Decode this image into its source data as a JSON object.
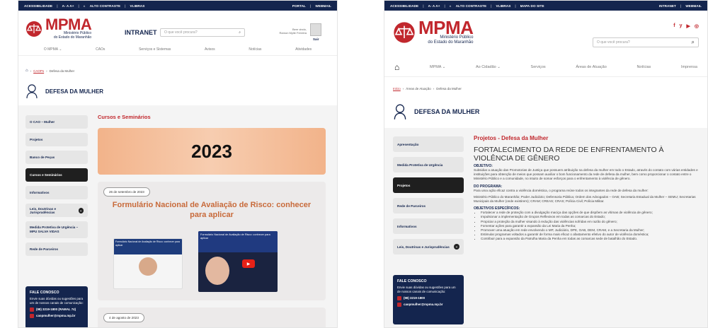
{
  "colors": {
    "navy": "#14254e",
    "red": "#c1272d"
  },
  "left": {
    "topbar": {
      "a11y": "ACESSIBILIDADE",
      "fonts": "A- A A+",
      "contrast": "ALTO CONTRASTE",
      "libras": "VLIBRAS",
      "portal": "PORTAL",
      "webmail": "WEBMAIL"
    },
    "logo": {
      "mp": "MPMA",
      "line1": "Ministério Público",
      "line2": "do Estado do Maranhão"
    },
    "intranet": "INTRANET",
    "search_placeholder": "O que você procura?",
    "user": {
      "greeting": "Bem vindo,",
      "name": "Ramon Mylle Ferreira",
      "logout": "Sair",
      "icon": "user-avatar-icon"
    },
    "nav": [
      "O MPMA",
      "CAOs",
      "Serviços e Sistemas",
      "Avisos",
      "Notícias",
      "Atividades"
    ],
    "breadcrumb": [
      "CAOPs",
      "Defesa da Mulher"
    ],
    "page_title": "DEFESA DA MULHER",
    "sidebar": [
      {
        "label": "O CAO – Mulher",
        "active": false
      },
      {
        "label": "Projetos",
        "active": false
      },
      {
        "label": "Banco de Peças",
        "active": false
      },
      {
        "label": "Cursos e Seminários",
        "active": true
      },
      {
        "label": "Informativos",
        "active": false
      },
      {
        "label": "Leis, Doutrinas e Jurisprudências",
        "active": false,
        "expand": true
      },
      {
        "label": "Medida Protetiva de Urgência – MPU SALVA VIDAS",
        "active": false
      },
      {
        "label": "Rede de Parceiros",
        "active": false
      }
    ],
    "contact": {
      "title": "FALE CONOSCO",
      "text": "Envie suas dúvidas ou sugestões para um de nossos canais de comunicação:",
      "phone": "(98) 3219-1800 (RAMAL 74)",
      "email": "caopmulher@mpma.mp.br"
    },
    "section_title": "Cursos e Seminários",
    "banner_year": "2023",
    "post1": {
      "date": "26 de setembro de 2023",
      "title": "Formulário Nacional de Avaliação de Risco: conhecer para aplicar",
      "thumb_text": "Formulário Nacional de Avaliação de Risco: conhecer para aplicar"
    },
    "post2": {
      "date": "4 de agosto de 2023"
    }
  },
  "right": {
    "topbar": {
      "a11y": "ACESSIBILIDADE",
      "fonts": "A- A A+",
      "contrast": "ALTO CONTRASTE",
      "libras": "VLIBRAS",
      "map": "MAPA DO SITE",
      "intranet": "INTRANET",
      "webmail": "WEBMAIL"
    },
    "logo": {
      "mp": "MPMA",
      "line1": "Ministério Público",
      "line2": "do Estado do Maranhão"
    },
    "social": [
      "f",
      "y",
      "▶",
      "◎"
    ],
    "search_placeholder": "O que você procura?",
    "nav": [
      "MPMA",
      "Ao Cidadão",
      "Serviços",
      "Áreas de Atuação",
      "Notícias",
      "Imprensa"
    ],
    "breadcrumb": [
      "Início",
      "Áreas de Atuação",
      "Defesa da Mulher"
    ],
    "page_title": "DEFESA DA MULHER",
    "sidebar": [
      {
        "label": "Apresentação",
        "active": false
      },
      {
        "label": "Medida Protetiva de Urgência",
        "active": false
      },
      {
        "label": "Projetos",
        "active": true
      },
      {
        "label": "Rede de Parceiros",
        "active": false
      },
      {
        "label": "Informativos",
        "active": false
      },
      {
        "label": "Leis, Doutrinas e Jurisprudências",
        "active": false,
        "expand": true
      }
    ],
    "contact": {
      "title": "FALE CONOSCO",
      "text": "Envie suas dúvidas ou sugestões para um de nossos canais de comunicação:",
      "phone": "(98) 3219-1800",
      "email": "caopmulher@mpma.mp.br"
    },
    "section_title": "Projetos - Defesa da Mulher",
    "article_title": "FORTALECIMENTO DA REDE DE ENFRENTAMENTO À VIOLÊNCIA DE GÊNERO",
    "objetivo_label": "OBJETIVO:",
    "objetivo": "Subsidiar a atuação das Promotorias de Justiça que possuem atribuição na defesa da mulher em todo o Estado, através do contato com várias entidades e instituições para obtenção de meios que possam auxiliar o bom funcionamento da rede de defesa da mulher, bem como proporcionar o contato entre o Ministério Público e a comunidade, no intuito de somar esforços para o enfrentamento à violência de gênero.",
    "programa_label": "DO PROGRAMA:",
    "programa": "Para uma ação eficaz contra a violência doméstica, o programa reúne todos os integrantes da rede de defesa da mulher:",
    "integrantes": "Ministério Público do Maranhão; Poder Judiciário; Defensoria Pública; Ordem dos Advogados – OAB; Secretaria Estadual da Mulher – SEMU; Secretarias Municipais da Mulher (onde existirem); CRAM; CREAS; CRAS; Polícia Civil; Polícia Militar.",
    "especificos_label": "OBJETIVOS ESPECÍFICOS:",
    "especificos": [
      "Fortalecer a rede de proteção com a divulgação maciça das opções de que dispõem as vítimas de violência de gênero;",
      "Impulsionar a implementação de Grupos Reflexivos em todas as comarcas do Estado;",
      "Propiciar a proteção da mulher visando à redução das violências sofridas em razão do gênero;",
      "Fomentar ações para garantir a expansão da Lei Maria da Penha;",
      "Promover uma atuação em rede envolvendo o MP, Judiciário, DPE, OAB, DEM, CRAM, e a Secretaria da Mulher;",
      "Estimular programas voltados a garantir de forma mais eficaz o afastamento efetivo do autor de violência doméstica;",
      "Contribuir para a expansão da Patrulha Maria da Penha em todas as comarcas sede de batalhão do Estado."
    ]
  }
}
